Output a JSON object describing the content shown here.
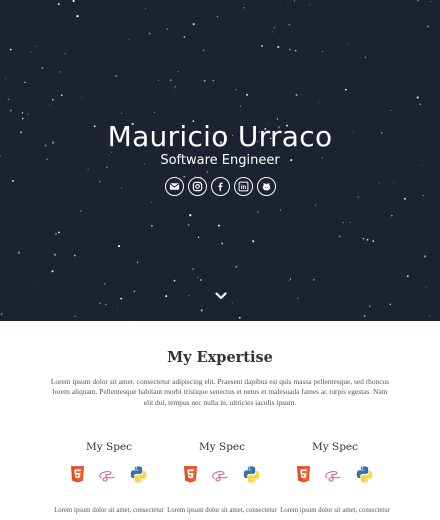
{
  "hero": {
    "name": "Mauricio Urraco",
    "role": "Software Engineer",
    "socials": [
      {
        "icon": "envelope-icon"
      },
      {
        "icon": "instagram-icon"
      },
      {
        "icon": "facebook-icon"
      },
      {
        "icon": "linkedin-icon"
      },
      {
        "icon": "github-icon"
      }
    ],
    "scroll_icon": "chevron-down-icon"
  },
  "expertise": {
    "title": "My Expertise",
    "description": "Lorem ipsum dolor sit amet, consectetur adipiscing elit. Praesent dapibus est quis massa pellentesque, sed rhoncus lorem aliquam. Pellentesque habitant morbi tristique senectus et netus et malesuada fames ac turpis egestas. Nam elit dui, tempus nec nulla in, ultricies iaculis ipsum.",
    "specs": [
      {
        "title": "My Spec",
        "icons": [
          "html5-icon",
          "sass-icon",
          "python-icon"
        ],
        "text": "Lorem ipsum dolor sit amet, consectetur"
      },
      {
        "title": "My Spec",
        "icons": [
          "html5-icon",
          "sass-icon",
          "python-icon"
        ],
        "text": "Lorem ipsum dolor sit amet, consectetur"
      },
      {
        "title": "My Spec",
        "icons": [
          "html5-icon",
          "sass-icon",
          "python-icon"
        ],
        "text": "Lorem ipsum dolor sit amet, consectetur"
      }
    ]
  },
  "colors": {
    "hero_bg": "#1d2231",
    "html5": "#e44d26",
    "sass": "#cd6799",
    "python_blue": "#3572a5",
    "python_yellow": "#ffd43b"
  }
}
